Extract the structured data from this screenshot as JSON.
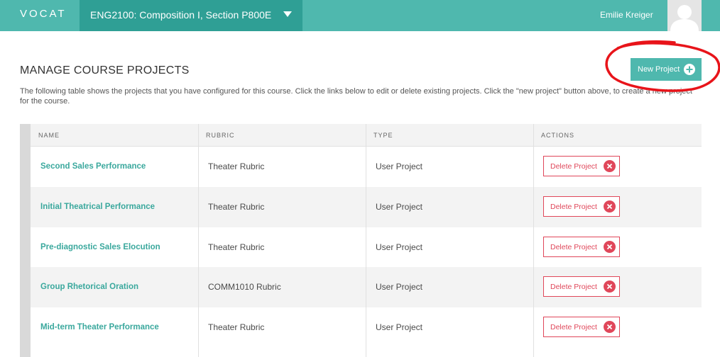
{
  "header": {
    "logo": "VOCAT",
    "course_title": "ENG2100: Composition I, Section P800E",
    "user_name": "Emilie Kreiger"
  },
  "page": {
    "title": "MANAGE COURSE PROJECTS",
    "description": "The following table shows the projects that you have configured for this course. Click the links below to edit or delete existing projects. Click the \"new project\" button above, to create a new project for the course.",
    "new_project_label": "New Project"
  },
  "table": {
    "columns": [
      "NAME",
      "RUBRIC",
      "TYPE",
      "ACTIONS"
    ],
    "delete_label": "Delete Project",
    "rows": [
      {
        "name": "Second Sales Performance",
        "rubric": "Theater Rubric",
        "type": "User Project"
      },
      {
        "name": "Initial Theatrical Performance",
        "rubric": "Theater Rubric",
        "type": "User Project"
      },
      {
        "name": "Pre-diagnostic Sales Elocution",
        "rubric": "Theater Rubric",
        "type": "User Project"
      },
      {
        "name": "Group Rhetorical Oration",
        "rubric": "COMM1010 Rubric",
        "type": "User Project"
      },
      {
        "name": "Mid-term Theater Performance",
        "rubric": "Theater Rubric",
        "type": "User Project"
      }
    ]
  },
  "colors": {
    "brand": "#4fb8ae",
    "brand_dark": "#2f9f95",
    "danger": "#e0475a",
    "annotation": "#e8141a"
  }
}
